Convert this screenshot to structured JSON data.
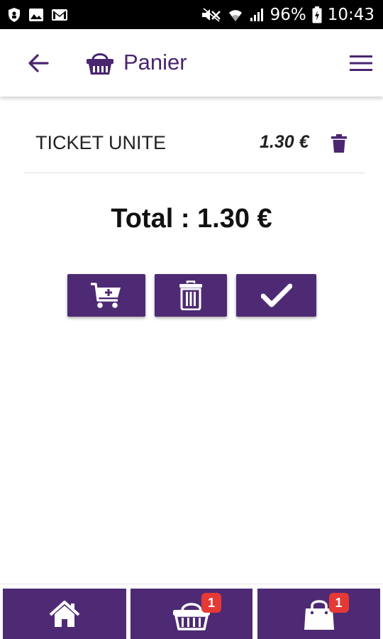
{
  "status_bar": {
    "battery": "96%",
    "time": "10:43",
    "icons": [
      "shield-icon",
      "image-icon",
      "gmail-icon",
      "mute-icon",
      "wifi-icon",
      "signal-icon",
      "battery-icon"
    ]
  },
  "app_bar": {
    "title": "Panier",
    "icons": {
      "back": "arrow-left-icon",
      "title": "basket-icon",
      "menu": "hamburger-menu-icon"
    },
    "accent_color": "#4a2570"
  },
  "cart": {
    "items": [
      {
        "name": "TICKET UNITE",
        "price": "1.30 €",
        "delete_icon": "trash-icon"
      }
    ],
    "total_label": "Total : 1.30 €"
  },
  "actions": [
    {
      "id": "add",
      "icon": "cart-plus-icon"
    },
    {
      "id": "clear",
      "icon": "trash-can-icon"
    },
    {
      "id": "validate",
      "icon": "checkmark-icon"
    }
  ],
  "bottom_nav": {
    "items": [
      {
        "id": "home",
        "icon": "home-icon",
        "badge": null
      },
      {
        "id": "basket",
        "icon": "basket-icon",
        "badge": "1"
      },
      {
        "id": "orders",
        "icon": "shopping-bag-icon",
        "badge": "1"
      }
    ],
    "button_color": "#4e2a74",
    "badge_color": "#e53935"
  }
}
